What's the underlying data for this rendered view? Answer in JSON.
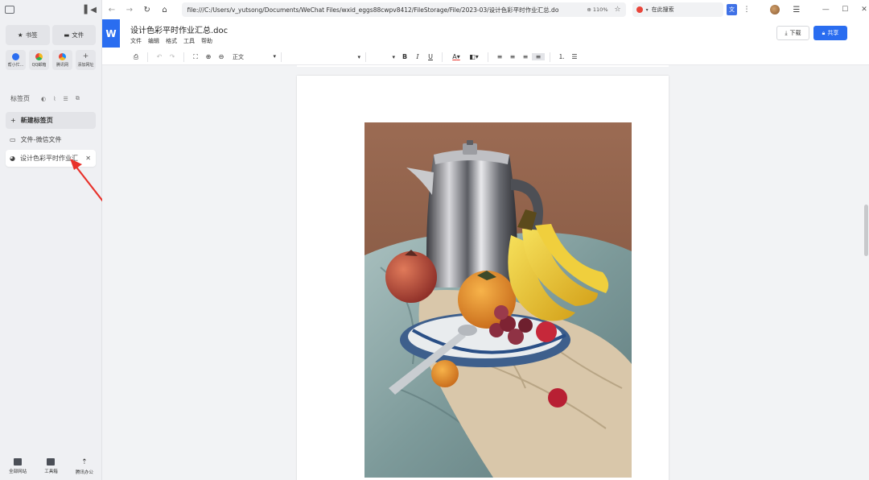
{
  "sidebar": {
    "tabs": [
      {
        "label": "书签",
        "icon": "star-icon"
      },
      {
        "label": "文件",
        "icon": "folder-icon"
      }
    ],
    "apps": [
      {
        "label": "帮小忙...",
        "color": "#2a6df0"
      },
      {
        "label": "QQ邮箱",
        "color": "#f5b821"
      },
      {
        "label": "腾讯网",
        "color": "#1a8cff"
      },
      {
        "label": "添加网址",
        "color": "#777777"
      }
    ],
    "section_title": "标签页",
    "new_tab_label": "新建标签页",
    "items": [
      {
        "label": "文件-微信文件"
      },
      {
        "label": "设计色彩平时作业汇"
      }
    ],
    "bottom": [
      {
        "label": "全部网站"
      },
      {
        "label": "工具箱"
      },
      {
        "label": "腾讯办公"
      }
    ]
  },
  "browser": {
    "url": "file:///C:/Users/v_yutsong/Documents/WeChat Files/wxid_eggs88cwpv8412/FileStorage/File/2023-03/设计色彩平时作业汇总.do",
    "zoom": "110%",
    "search_placeholder": "在此搜索"
  },
  "doc": {
    "title": "设计色彩平时作业汇总.doc",
    "logo": "W",
    "menu": [
      "文件",
      "编辑",
      "格式",
      "工具",
      "帮助"
    ],
    "download_label": "下载",
    "share_label": "共享"
  },
  "toolbar": {
    "style_value": "正文",
    "bold": "B",
    "italic": "I",
    "underline": "U",
    "font_color": "A"
  },
  "colors": {
    "accent": "#2a6df0",
    "annotation_arrow": "#e8322b"
  }
}
